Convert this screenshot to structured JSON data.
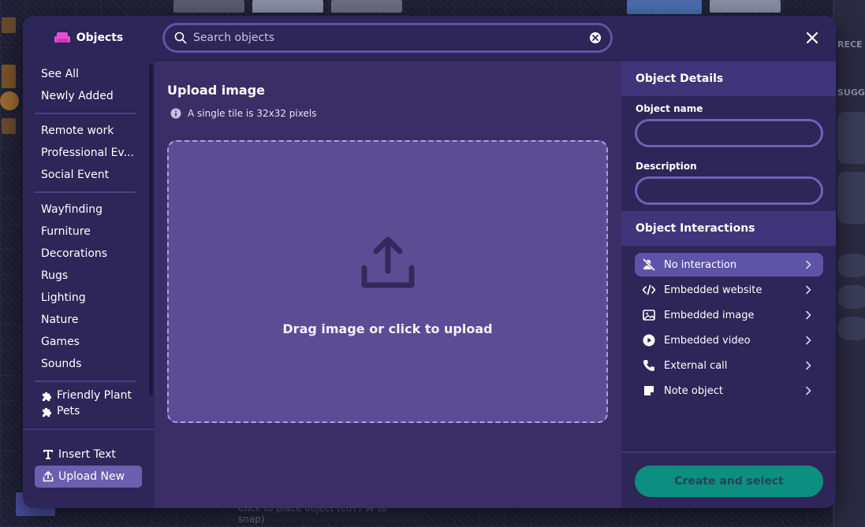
{
  "app": {
    "title": "Objects"
  },
  "sidebar": {
    "items": [
      {
        "label": "See All"
      },
      {
        "label": "Newly Added"
      },
      {
        "separator": true
      },
      {
        "label": "Remote work"
      },
      {
        "label": "Professional Ev..."
      },
      {
        "label": "Social Event"
      },
      {
        "separator": true
      },
      {
        "label": "Wayfinding"
      },
      {
        "label": "Furniture"
      },
      {
        "label": "Decorations"
      },
      {
        "label": "Rugs"
      },
      {
        "label": "Lighting"
      },
      {
        "label": "Nature"
      },
      {
        "label": "Games"
      },
      {
        "label": "Sounds"
      },
      {
        "separator": true
      },
      {
        "label": "Friendly Plant",
        "icon": "puzzle-icon"
      },
      {
        "label": "Pets",
        "icon": "puzzle-icon"
      }
    ],
    "bottom": {
      "insert_text": "Insert Text",
      "upload_new": "Upload New"
    }
  },
  "search": {
    "placeholder": "Search objects",
    "value": ""
  },
  "upload": {
    "title": "Upload image",
    "hint": "A single tile is 32x32 pixels",
    "dropzone_text": "Drag image or click to upload"
  },
  "details": {
    "heading": "Object Details",
    "name_label": "Object name",
    "name_value": "",
    "description_label": "Description",
    "description_value": ""
  },
  "interactions": {
    "heading": "Object Interactions",
    "items": [
      {
        "label": "No interaction",
        "icon": "no-interaction-icon",
        "selected": true
      },
      {
        "label": "Embedded website",
        "icon": "code-icon",
        "selected": false
      },
      {
        "label": "Embedded image",
        "icon": "image-icon",
        "selected": false
      },
      {
        "label": "Embedded video",
        "icon": "play-icon",
        "selected": false
      },
      {
        "label": "External call",
        "icon": "phone-icon",
        "selected": false
      },
      {
        "label": "Note object",
        "icon": "note-icon",
        "selected": false
      }
    ]
  },
  "actions": {
    "create_label": "Create and select"
  },
  "background": {
    "side_labels": [
      "RECE",
      "SUGG"
    ],
    "canvas_hint": "Click to place object (ctrl / ⌘ to snap)"
  },
  "colors": {
    "modal_bg": "#3b2e66",
    "panel_bg": "#2e2558",
    "accent": "#5f53a8",
    "dropzone": "#5a4d94",
    "create_button": "#0c8f80",
    "brand_icon": "#e84fd2"
  }
}
